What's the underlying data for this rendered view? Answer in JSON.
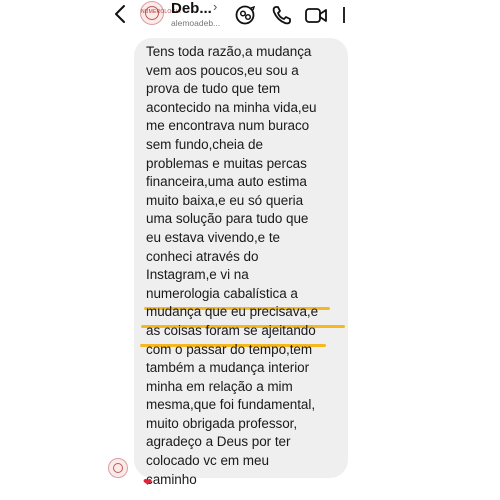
{
  "header": {
    "back_label": "back",
    "contact_name": "Deb...",
    "contact_username": "alemoadeb...",
    "avatar_icon": "profile-avatar-icon",
    "avatar_text": "NUMEROLOGIA"
  },
  "message": {
    "text": "Tens toda razão,a mudança\nvem aos poucos,eu sou a\nprova de tudo que tem\nacontecido na minha vida,eu\nme encontrava num buraco\nsem fundo,cheia de\nproblemas e muitas percas\nfinanceira,uma auto estima\nmuito baixa,e eu só queria\numa solução para tudo que\neu estava vivendo,e te\nconheci através do\nInstagram,e vi na\nnumerologia cabalística a\nmudança que eu precisava,e\nas coisas foram se ajeitando\ncom o passar do tempo,tem\ntambém a mudança interior\nminha em relação a mim\nmesma,que foi fundamental,\nmuito obrigada professor,\nagradeço a Deus por ter\ncolocado vc em meu\ncaminho",
    "highlight_color": "#f5b91f",
    "reaction": "❤"
  },
  "icons": {
    "back": "chevron-left-icon",
    "name_chevron": "chevron-right-icon",
    "avatar_sync": "avatar-sync-icon",
    "call": "phone-icon",
    "video": "video-camera-icon"
  }
}
